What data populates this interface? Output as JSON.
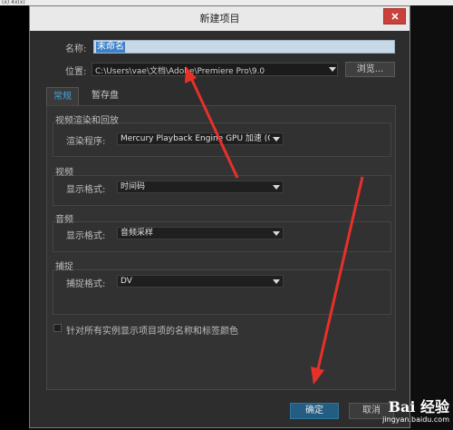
{
  "top_strip": "(x) 4x(x)",
  "window": {
    "title": "新建项目",
    "close_glyph": "✕"
  },
  "name_label": "名称:",
  "name_value": "未命名",
  "location_label": "位置:",
  "location_path": "C:\\Users\\vae\\文档\\Adobe\\Premiere Pro\\9.0",
  "browse_label": "浏览...",
  "tabs": [
    {
      "label": "常规",
      "active": true
    },
    {
      "label": "暂存盘",
      "active": false
    }
  ],
  "sections": {
    "render": {
      "title": "视频渲染和回放",
      "field_label": "渲染程序:",
      "value": "Mercury Playback Engine GPU 加速 (OpenCL)"
    },
    "video": {
      "title": "视频",
      "field_label": "显示格式:",
      "value": "时间码"
    },
    "audio": {
      "title": "音频",
      "field_label": "显示格式:",
      "value": "音频采样"
    },
    "capture": {
      "title": "捕捉",
      "field_label": "捕捉格式:",
      "value": "DV"
    }
  },
  "checkbox_label": "针对所有实例显示项目项的名称和标签颜色",
  "ok_label": "确定",
  "cancel_label": "取消",
  "watermark": {
    "line1": "Bai 经验",
    "line2": "jingyan.baidu.com"
  },
  "colors": {
    "accent_tab": "#46a2da",
    "annotation_arrow": "#e8302a",
    "ok_button": "#245d82"
  }
}
